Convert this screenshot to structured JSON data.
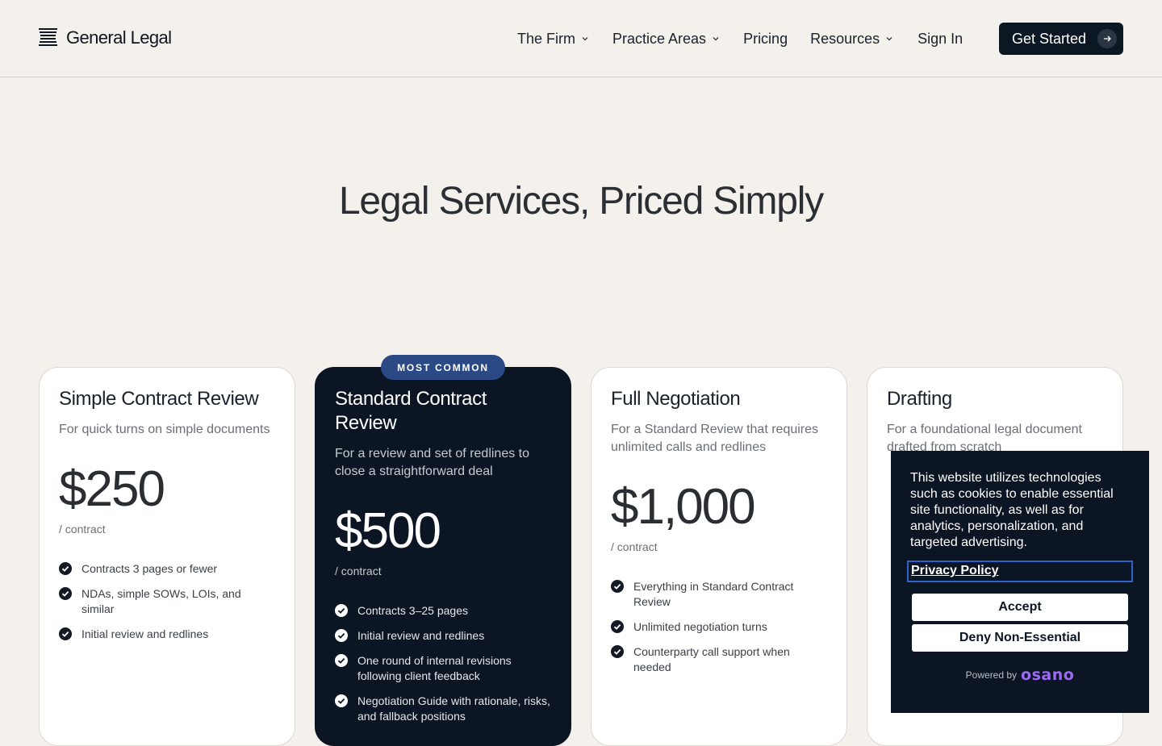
{
  "brand": {
    "name": "General Legal",
    "icon": "stacked-lines-logo-icon"
  },
  "nav": {
    "items": [
      {
        "label": "The Firm",
        "has_dropdown": true
      },
      {
        "label": "Practice Areas",
        "has_dropdown": true
      },
      {
        "label": "Pricing",
        "has_dropdown": false
      },
      {
        "label": "Resources",
        "has_dropdown": true
      },
      {
        "label": "Sign In",
        "has_dropdown": false
      }
    ],
    "cta": {
      "label": "Get Started",
      "icon": "arrow-right-icon"
    }
  },
  "hero": {
    "title": "Legal Services, Priced Simply"
  },
  "badge": "MOST COMMON",
  "plans": [
    {
      "title": "Simple Contract Review",
      "description": "For quick turns on simple documents",
      "price": "$250",
      "unit": "/ contract",
      "features": [
        "Contracts 3 pages or fewer",
        "NDAs, simple SOWs, LOIs, and similar",
        "Initial review and redlines"
      ]
    },
    {
      "title": "Standard Contract Review",
      "description": "For a review and set of redlines to close a straightforward deal",
      "price": "$500",
      "unit": "/ contract",
      "featured": true,
      "features": [
        "Contracts 3–25 pages",
        "Initial review and redlines",
        "One round of internal revisions following client feedback",
        "Negotiation Guide with rationale, risks, and fallback positions"
      ]
    },
    {
      "title": "Full Negotiation",
      "description": "For a Standard Review that requires unlimited calls and redlines",
      "price": "$1,000",
      "unit": "/ contract",
      "features": [
        "Everything in Standard Contract Review",
        "Unlimited negotiation turns",
        "Counterparty call support when needed"
      ]
    },
    {
      "title": "Drafting",
      "description": "For a foundational legal document drafted from scratch",
      "price": "",
      "unit": "",
      "features": []
    }
  ],
  "cookie": {
    "text": "This website utilizes technologies such as cookies to enable essential site functionality, as well as for analytics, personalization, and targeted advertising.",
    "privacy_link": "Privacy Policy",
    "accept_label": "Accept",
    "deny_label": "Deny Non-Essential",
    "powered_by": "Powered by",
    "powered_brand": "osano"
  },
  "colors": {
    "background": "#f4f1ed",
    "dark_navy": "#0c1523",
    "badge_blue": "#2b4a85",
    "osano_purple": "#9c6bf5",
    "focus_outline": "#2f62c8"
  }
}
